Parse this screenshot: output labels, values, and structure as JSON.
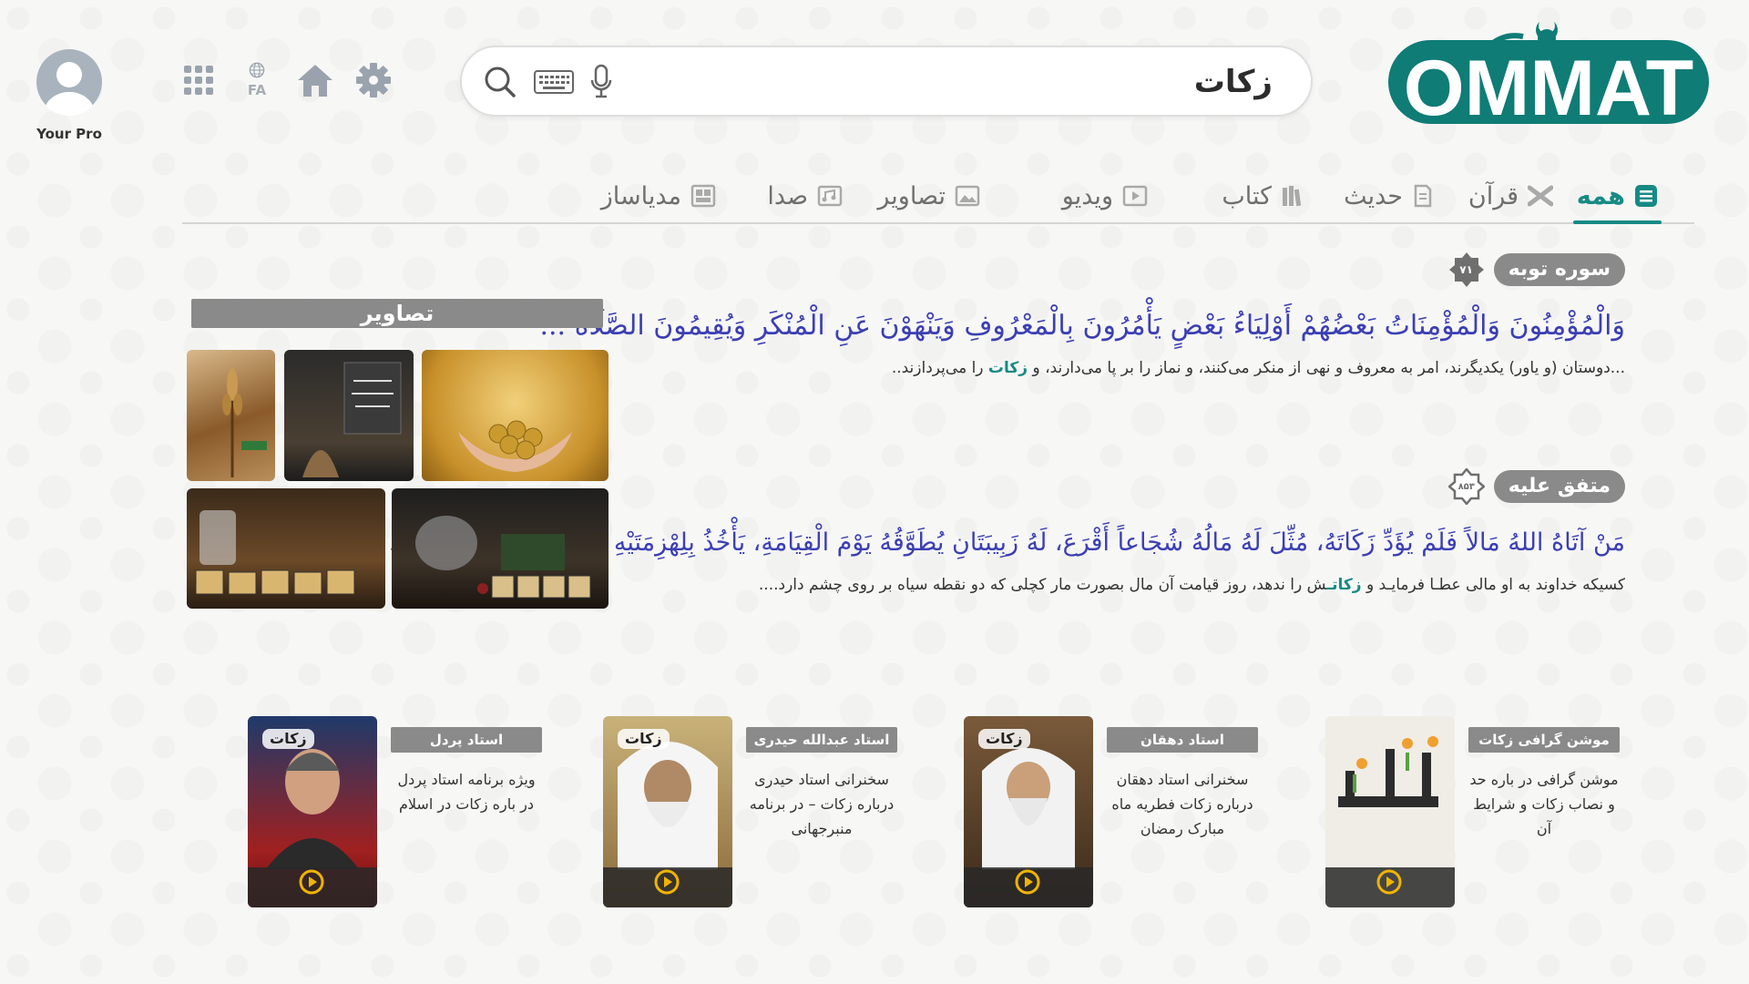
{
  "header": {
    "logo_text": "OMMAT",
    "search": {
      "query": "زکات"
    },
    "language": "FA",
    "profile_name": "Your Pro"
  },
  "icons": {
    "search": "search-icon",
    "keyboard": "keyboard-icon",
    "mic": "microphone-icon",
    "apps": "apps-grid-icon",
    "globe": "globe-icon",
    "home": "home-icon",
    "settings": "gear-icon",
    "avatar": "user-avatar-icon",
    "play": "play-icon"
  },
  "tabs": [
    {
      "label": "همه",
      "icon": "list-icon",
      "active": true
    },
    {
      "label": "قرآن",
      "icon": "quran-icon",
      "active": false
    },
    {
      "label": "حدیث",
      "icon": "hadith-icon",
      "active": false
    },
    {
      "label": "کتاب",
      "icon": "books-icon",
      "active": false
    },
    {
      "label": "ویدیو",
      "icon": "video-icon",
      "active": false
    },
    {
      "label": "تصاویر",
      "icon": "image-icon",
      "active": false
    },
    {
      "label": "صدا",
      "icon": "audio-icon",
      "active": false
    },
    {
      "label": "مدیاساز",
      "icon": "media-maker-icon",
      "active": false
    }
  ],
  "results": [
    {
      "source": "سوره توبه",
      "number": "۷۱",
      "arabic": "وَالْمُؤْمِنُونَ وَالْمُؤْمِنَاتُ بَعْضُهُمْ أَوْلِيَاءُ بَعْضٍ يَأْمُرُونَ بِالْمَعْرُوفِ وَيَنْهَوْنَ عَنِ الْمُنْكَرِ وَيُقِيمُونَ الصَّلَاةَ ...",
      "translation_before": "...دوستان (و یاور) یکدیگرند، امر به معروف و نهی از منکر می‌کنند، و نماز را بر پا می‌دارند، و ",
      "translation_highlight": "زکات",
      "translation_after": " را می‌پردازند.."
    },
    {
      "source": "متفق علیه",
      "number": "۸۵۳",
      "arabic": "مَنْ آتَاهُ اللهُ مَالاً فَلَمْ يُؤَدِّ زَكَاتَهُ، مُثِّلَ لَهُ مَالُهُ شُجَاعاً أَقْرَعَ، لَهُ زَبِيبَتَانِ يُطَوَّقُهُ يَوْمَ الْقِيَامَةِ، يَأْخُذُ بِلِهْزِمَتَيْهِ يَعْنِي بِشِدْقَيْهِ يَقُولُ....",
      "translation_before": "کسیکه خداوند به او مالی عطـا فرمایـد و ",
      "translation_highlight": "زکاتـ",
      "translation_after": "ش را ندهد، روز قیامت آن مال بصورت مار کچلی که دو نقطه سیاه بر روی چشم دارد...."
    }
  ],
  "images_panel": {
    "title": "تصاویر"
  },
  "cards": [
    {
      "speaker": "موشن گرافی زکات",
      "desc": "موشن گرافی در باره حد و نصاب زکات و شرایط آن",
      "tag": "",
      "thumb": "motion"
    },
    {
      "speaker": "استاد دهقان",
      "desc": "سخنرانی استاد دهقان درباره زکات فطریه ماه مبارک رمضان",
      "tag": "زکات",
      "thumb": "dehghan"
    },
    {
      "speaker": "استاد عبدالله حیدری",
      "desc": "سخنرانی استاد حیدری درباره زکات – در برنامه منبرجهانی",
      "tag": "زکات",
      "thumb": "heidari"
    },
    {
      "speaker": "استاد پردل",
      "desc": "ویژه برنامه استاد پردل در باره زکات در اسلام",
      "tag": "زکات",
      "thumb": "pordel"
    }
  ],
  "colors": {
    "accent": "#178a84",
    "arabic_text": "#3b3fb3",
    "badge_gray": "#8a8a8a"
  }
}
